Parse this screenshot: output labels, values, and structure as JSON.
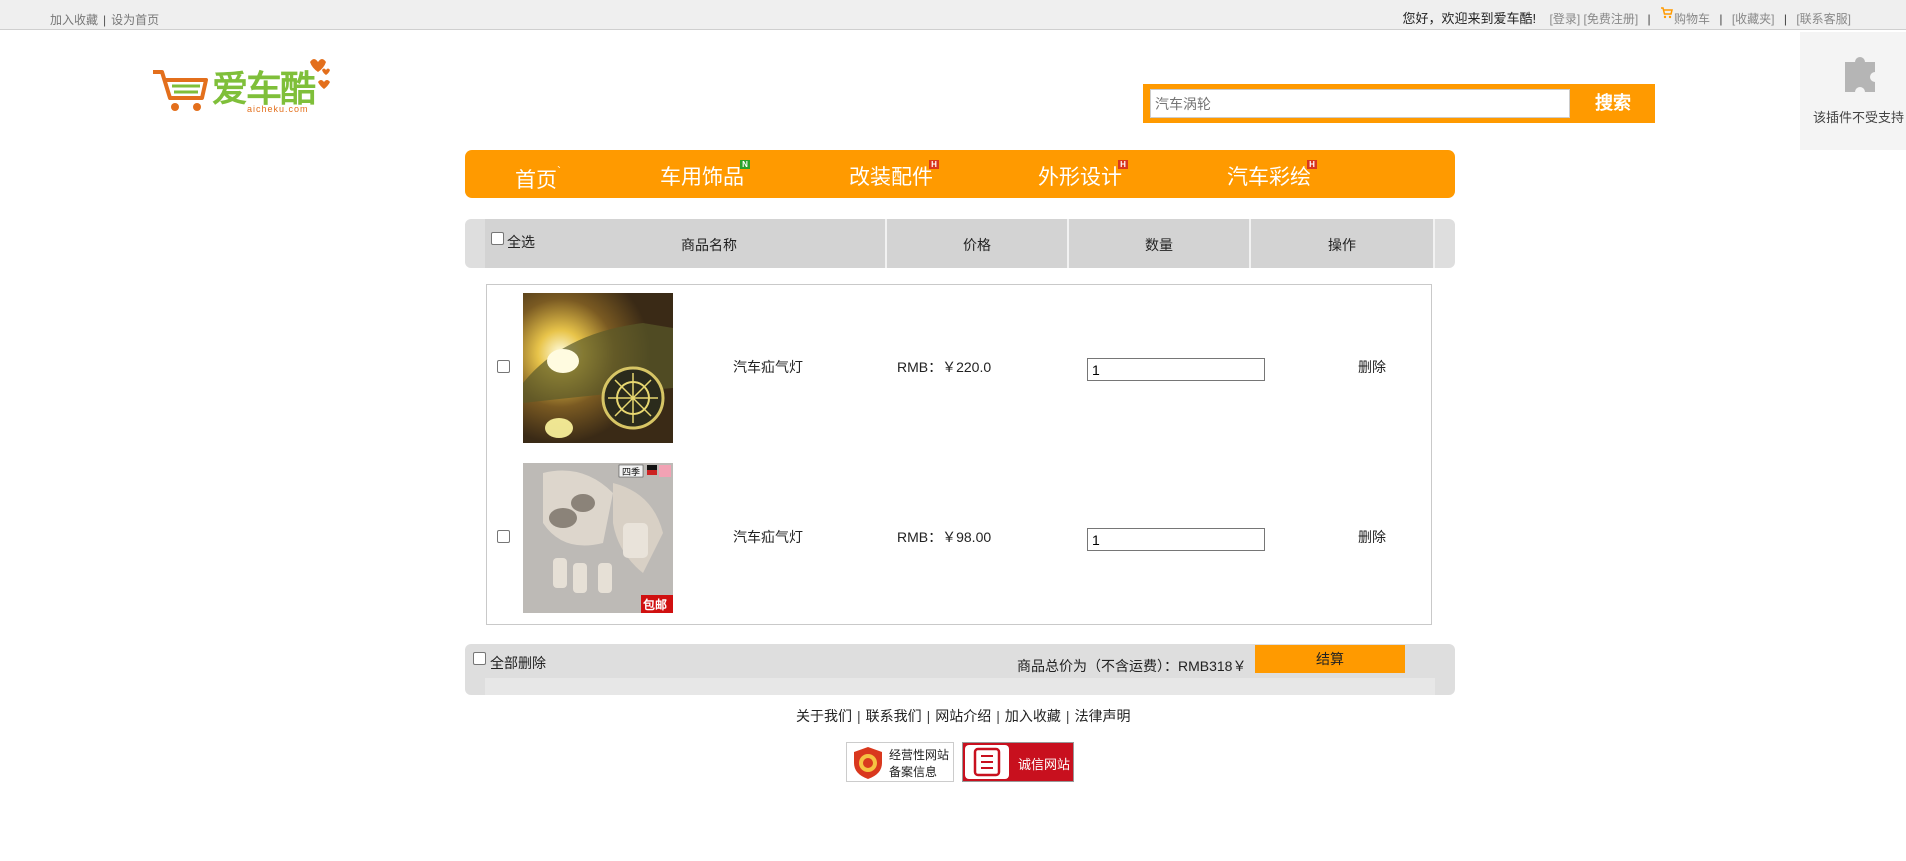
{
  "topbar": {
    "add_favorite": "加入收藏",
    "set_homepage": "设为首页",
    "welcome": "您好，欢迎来到爱车酷!",
    "login": "[登录]",
    "register": "[免费注册]",
    "cart": "购物车",
    "favorites": "[收藏夹]",
    "service": "[联系客服]"
  },
  "logo": {
    "brand": "爱车酷",
    "domain": "aicheku.com"
  },
  "search": {
    "placeholder": "汽车涡轮",
    "button": "搜索"
  },
  "plugin": {
    "message": "该插件不受支持"
  },
  "nav": {
    "items": [
      {
        "label": "首页",
        "mark": "`"
      },
      {
        "label": "车用饰品",
        "badge": "N"
      },
      {
        "label": "改装配件",
        "badge": "H"
      },
      {
        "label": "外形设计",
        "badge": "H"
      },
      {
        "label": "汽车彩绘",
        "badge": "H"
      }
    ]
  },
  "table": {
    "select_all": "全选",
    "headers": [
      "商品名称",
      "价格",
      "数量",
      "操作"
    ]
  },
  "cart": {
    "items": [
      {
        "name": "汽车疝气灯",
        "price": "RMB：￥220.0",
        "quantity": "1",
        "action": "删除",
        "image_icon": "car-headlight-photo"
      },
      {
        "name": "汽车疝气灯",
        "price": "RMB：￥98.00",
        "quantity": "1",
        "action": "删除",
        "image_icon": "car-seat-accessories-photo",
        "image_tag": "包邮",
        "image_logo": "四季"
      }
    ]
  },
  "summary": {
    "delete_all": "全部删除",
    "total_label": "商品总价为（不含运费）：RMB318￥",
    "checkout": "结算"
  },
  "footer": {
    "links": [
      "关于我们",
      "联系我们",
      "网站介绍",
      "加入收藏",
      "法律声明"
    ],
    "badge1_line1": "经营性网站",
    "badge1_line2": "备案信息",
    "badge2": "诚信网站"
  },
  "colors": {
    "accent": "#ff9a00",
    "logo_green": "#7fbf3a",
    "logo_orange": "#e36f1c",
    "trust_red": "#c8101e"
  }
}
